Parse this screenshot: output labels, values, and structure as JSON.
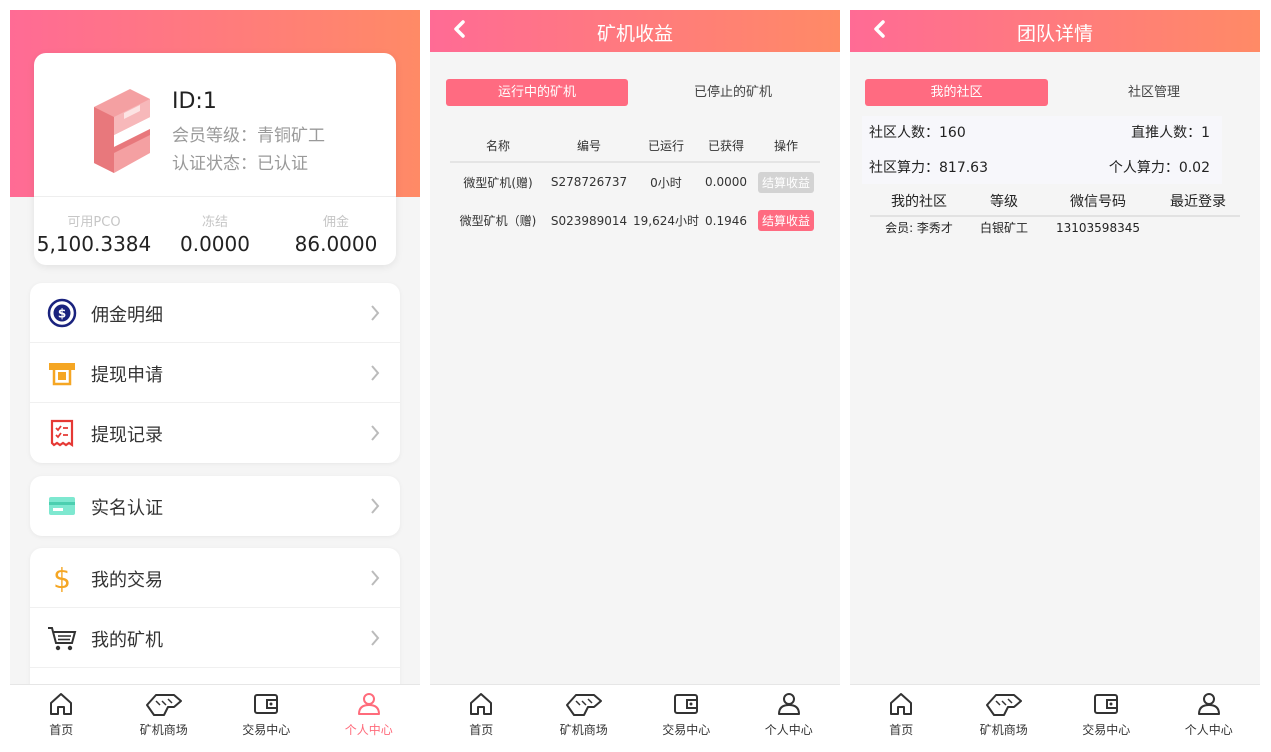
{
  "tabbar": {
    "items": [
      {
        "label": "首页",
        "icon": "home-icon"
      },
      {
        "label": "矿机商场",
        "icon": "miner-icon"
      },
      {
        "label": "交易中心",
        "icon": "wallet-icon"
      },
      {
        "label": "个人中心",
        "icon": "user-icon"
      }
    ]
  },
  "profile": {
    "id": "ID:1",
    "level": "会员等级：青铜矿工",
    "auth": "认证状态：已认证",
    "stats": [
      {
        "label": "可用PCO",
        "value": "5,100.3384"
      },
      {
        "label": "冻结",
        "value": "0.0000"
      },
      {
        "label": "佣金",
        "value": "86.0000"
      }
    ]
  },
  "menu": {
    "group1": [
      {
        "label": "佣金明细",
        "icon": "dollar-coin-icon"
      },
      {
        "label": "提现申请",
        "icon": "atm-withdraw-icon"
      },
      {
        "label": "提现记录",
        "icon": "receipt-checklist-icon"
      }
    ],
    "group2": [
      {
        "label": "实名认证",
        "icon": "id-card-icon"
      }
    ],
    "group3": [
      {
        "label": "我的交易",
        "icon": "dollar-sign-icon"
      },
      {
        "label": "我的矿机",
        "icon": "shopping-cart-icon"
      }
    ]
  },
  "miner_page": {
    "title": "矿机收益",
    "tabs": [
      "运行中的矿机",
      "已停止的矿机"
    ],
    "columns": [
      "名称",
      "编号",
      "已运行",
      "已获得",
      "操作"
    ],
    "rows": [
      {
        "name": "微型矿机(赠)",
        "code": "S278726737",
        "run": "0小时",
        "earned": "0.0000",
        "action": "结算收益",
        "state": "disabled"
      },
      {
        "name": "微型矿机（赠)",
        "code": "S023989014",
        "run": "19,624小时",
        "earned": "0.1946",
        "action": "结算收益",
        "state": "active"
      }
    ]
  },
  "team_page": {
    "title": "团队详情",
    "tabs": [
      "我的社区",
      "社区管理"
    ],
    "stats": {
      "community_count": "社区人数：160",
      "direct_count": "直推人数：1",
      "community_power": "社区算力：817.63",
      "personal_power": "个人算力：0.02"
    },
    "columns": [
      "我的社区",
      "等级",
      "微信号码",
      "最近登录"
    ],
    "rows": [
      {
        "member": "会员: 李秀才",
        "level": "白银矿工",
        "wechat": "13103598345",
        "last_login": ""
      }
    ]
  },
  "colors": {
    "accent": "#ff6b81",
    "gradient_start": "#ff6b95",
    "gradient_end": "#ff8a66"
  }
}
